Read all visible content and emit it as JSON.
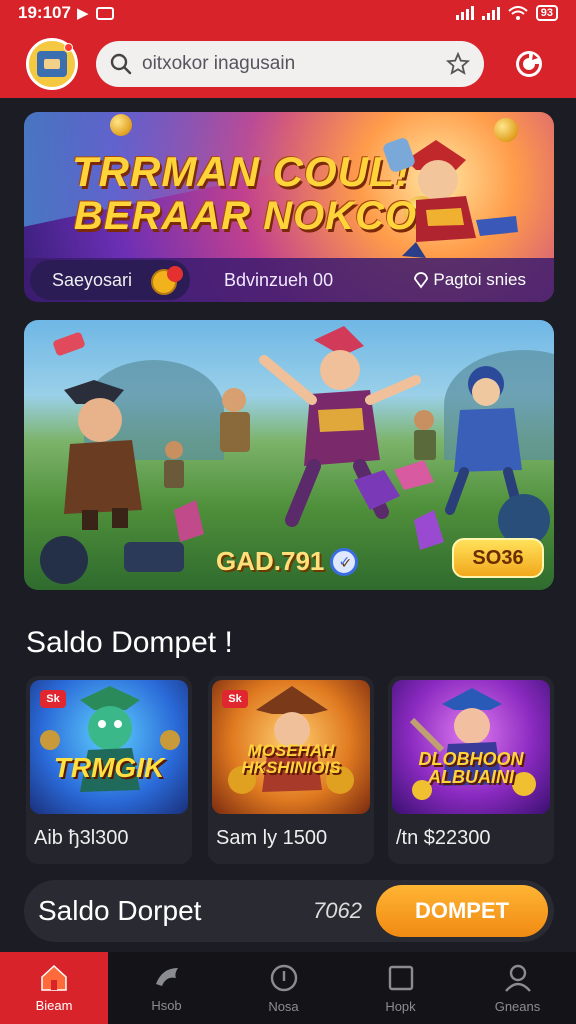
{
  "status_bar": {
    "time": "19:107",
    "battery": "93",
    "status_icons": [
      "play-icon",
      "notification-icon",
      "signal-icon",
      "wifi-icon",
      "battery-icon"
    ]
  },
  "header": {
    "search_placeholder": "oitxokor inagusain",
    "search_icon": "search-icon",
    "favorite_icon": "star-icon",
    "action_icon": "refresh-icon",
    "accent_color": "#d8232a"
  },
  "hero": {
    "title_line1": "TRRMAN COUL!",
    "title_line2": "BERAAR NOKCO",
    "strip_left": "Saeyosari",
    "strip_mid": "Bdvinzueh 00",
    "strip_right": "Pagtoi snies"
  },
  "scene": {
    "amount": "GAD.791",
    "badge": "SO36"
  },
  "section": {
    "title": "Saldo Dompet !"
  },
  "games": [
    {
      "tag": "Sk",
      "title": "TRMGIK",
      "price": "Aib ђ3l300"
    },
    {
      "tag": "Sk",
      "title": "MOSEHAH HKSHINIOIS",
      "price": "Sam ly 1500"
    },
    {
      "tag": "",
      "title": "DLOBHOON ALBUAINI",
      "price": "/tn $22300"
    }
  ],
  "balance": {
    "label": "Saldo Dorpet",
    "value": "7062",
    "button": "DOMPET",
    "button_color": "#f5a023"
  },
  "nav": [
    {
      "label": "Bieam",
      "icon": "home-icon",
      "active": true
    },
    {
      "label": "Hsob",
      "icon": "bird-icon",
      "active": false
    },
    {
      "label": "Nosa",
      "icon": "info-icon",
      "active": false
    },
    {
      "label": "Hopk",
      "icon": "square-icon",
      "active": false
    },
    {
      "label": "Gneans",
      "icon": "user-icon",
      "active": false
    }
  ]
}
